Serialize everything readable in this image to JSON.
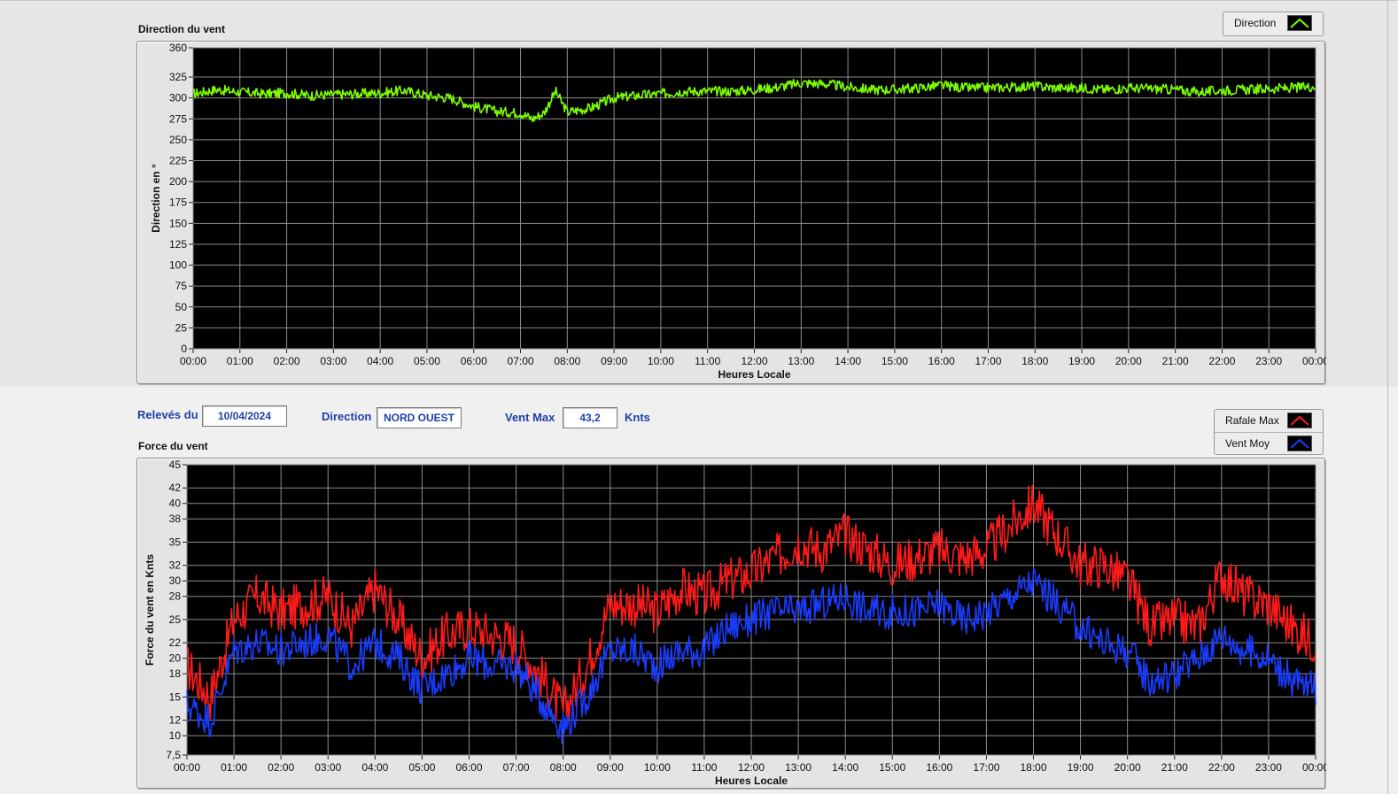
{
  "direction_panel": {
    "title": "Direction du vent",
    "legend": [
      {
        "label": "Direction",
        "color": "#7CFC00"
      }
    ]
  },
  "force_panel": {
    "title": "Force du vent",
    "legend": [
      {
        "label": "Rafale Max",
        "color": "#ff1a1a"
      },
      {
        "label": "Vent Moy",
        "color": "#1a3cff"
      }
    ]
  },
  "controls": {
    "date_label": "Relevés du",
    "date_value": "10/04/2024",
    "direction_label": "Direction",
    "direction_value": "NORD OUEST",
    "vent_max_label": "Vent Max",
    "vent_max_value": "43,2",
    "unit": "Knts"
  },
  "chart_data": [
    {
      "type": "line",
      "title": "",
      "xlabel": "Heures Locale",
      "ylabel": "Direction en °",
      "xticks": [
        "00:00",
        "01:00",
        "02:00",
        "03:00",
        "04:00",
        "05:00",
        "06:00",
        "07:00",
        "08:00",
        "09:00",
        "10:00",
        "11:00",
        "12:00",
        "13:00",
        "14:00",
        "15:00",
        "16:00",
        "17:00",
        "18:00",
        "19:00",
        "20:00",
        "21:00",
        "22:00",
        "23:00",
        "00:00"
      ],
      "yticks": [
        "0",
        "25",
        "50",
        "75",
        "100",
        "125",
        "150",
        "175",
        "200",
        "225",
        "250",
        "275",
        "300",
        "325",
        "360"
      ],
      "ylim": [
        0,
        360
      ],
      "grid": true,
      "series": [
        {
          "name": "Direction",
          "color": "#7CFC00",
          "x_hours": [
            0,
            0.5,
            1,
            1.5,
            2,
            2.5,
            3,
            3.5,
            4,
            4.5,
            5,
            5.5,
            6,
            6.5,
            7,
            7.25,
            7.5,
            7.75,
            8,
            8.5,
            9,
            9.5,
            10,
            10.5,
            11,
            11.5,
            12,
            12.5,
            13,
            13.5,
            14,
            14.5,
            15,
            15.5,
            16,
            16.5,
            17,
            17.5,
            18,
            18.5,
            19,
            19.5,
            20,
            20.5,
            21,
            21.5,
            22,
            22.5,
            23,
            23.5,
            24
          ],
          "values": [
            305,
            310,
            307,
            305,
            306,
            303,
            304,
            305,
            306,
            309,
            303,
            300,
            290,
            284,
            282,
            275,
            282,
            308,
            283,
            288,
            300,
            303,
            305,
            308,
            308,
            308,
            310,
            313,
            318,
            317,
            313,
            310,
            310,
            312,
            315,
            312,
            312,
            313,
            314,
            312,
            312,
            310,
            312,
            311,
            310,
            307,
            309,
            310,
            311,
            312,
            314
          ]
        }
      ]
    },
    {
      "type": "line",
      "title": "",
      "xlabel": "Heures Locale",
      "ylabel": "Force du vent en Knts",
      "xticks": [
        "00:00",
        "01:00",
        "02:00",
        "03:00",
        "04:00",
        "05:00",
        "06:00",
        "07:00",
        "08:00",
        "09:00",
        "10:00",
        "11:00",
        "12:00",
        "13:00",
        "14:00",
        "15:00",
        "16:00",
        "17:00",
        "18:00",
        "19:00",
        "20:00",
        "21:00",
        "22:00",
        "23:00",
        "00:00"
      ],
      "yticks": [
        "7,5",
        "10",
        "12",
        "15",
        "18",
        "20",
        "22",
        "25",
        "28",
        "30",
        "32",
        "35",
        "38",
        "40",
        "42",
        "45"
      ],
      "ylim": [
        7.5,
        45
      ],
      "grid": true,
      "x_hours": [
        0,
        0.5,
        1,
        1.5,
        2,
        2.5,
        3,
        3.5,
        4,
        4.5,
        5,
        5.5,
        6,
        6.5,
        7,
        7.5,
        8,
        8.5,
        9,
        9.5,
        10,
        10.5,
        11,
        11.5,
        12,
        12.5,
        13,
        13.5,
        14,
        14.5,
        15,
        15.5,
        16,
        16.5,
        17,
        17.5,
        18,
        18.5,
        19,
        19.5,
        20,
        20.5,
        21,
        21.5,
        22,
        22.5,
        23,
        23.5,
        24
      ],
      "series": [
        {
          "name": "Rafale Max",
          "color": "#ff1a1a",
          "values": [
            19,
            15,
            25,
            28,
            26,
            27,
            28,
            24,
            29,
            25,
            20,
            23,
            24,
            23,
            22,
            18,
            13,
            19,
            27,
            27,
            26,
            29,
            28,
            30,
            31,
            33,
            35,
            34,
            36,
            34,
            32,
            33,
            34,
            33,
            34,
            37,
            40,
            36,
            32,
            32,
            30,
            24,
            25,
            24,
            31,
            28,
            27,
            24,
            22
          ]
        },
        {
          "name": "Vent Moy",
          "color": "#1a3cff",
          "values": [
            14,
            12,
            21,
            22,
            21,
            22,
            23,
            19,
            22,
            20,
            16,
            18,
            20,
            19,
            19,
            15,
            11,
            15,
            21,
            21,
            19,
            21,
            21,
            24,
            25,
            26,
            26,
            27,
            28,
            26,
            26,
            26,
            27,
            25,
            26,
            28,
            30,
            27,
            24,
            22,
            21,
            17,
            18,
            20,
            23,
            21,
            20,
            17,
            16
          ]
        }
      ]
    }
  ]
}
